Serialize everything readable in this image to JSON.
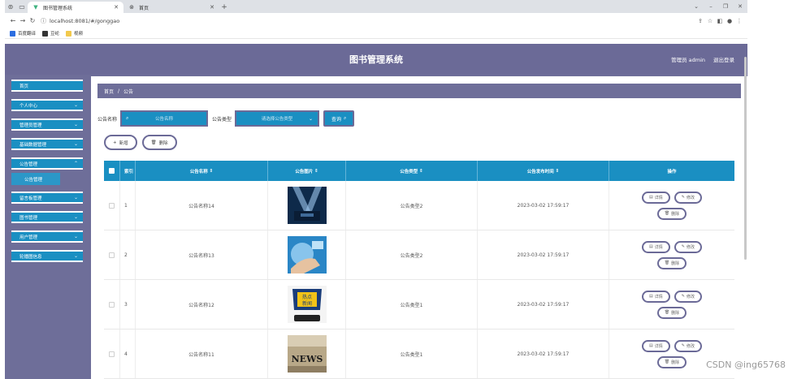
{
  "browser": {
    "tabs": [
      {
        "title": "图书管理系统",
        "active": true
      },
      {
        "title": "首页",
        "active": false
      }
    ],
    "new_tab": "+",
    "url": "localhost:8081/#/gonggao",
    "bookmarks": [
      "百度翻译",
      "豆纶",
      "视频"
    ]
  },
  "app": {
    "title": "图书管理系统",
    "user_label": "管理员 admin",
    "logout": "退出登录"
  },
  "sidebar": {
    "items": [
      {
        "label": "首页",
        "has_children": false
      },
      {
        "label": "个人中心",
        "has_children": true
      },
      {
        "label": "管理员管理",
        "has_children": true
      },
      {
        "label": "基础数据管理",
        "has_children": true
      },
      {
        "label": "公告管理",
        "has_children": true,
        "expanded": true
      },
      {
        "label": "留言板管理",
        "has_children": true
      },
      {
        "label": "图书管理",
        "has_children": true
      },
      {
        "label": "用户管理",
        "has_children": true
      },
      {
        "label": "轮播图信息",
        "has_children": true
      }
    ],
    "active_sub": "公告管理"
  },
  "breadcrumb": {
    "home": "首页",
    "sep": "/",
    "current": "公告"
  },
  "filters": {
    "name_label": "公告名称",
    "name_placeholder": "公告名称",
    "type_label": "公告类型",
    "type_placeholder": "请选择公告类型",
    "search_button": "查询"
  },
  "actions": {
    "add": "新增",
    "delete": "删除"
  },
  "table": {
    "headers": [
      "索引",
      "公告名称",
      "公告图片",
      "公告类型",
      "公告发布时间",
      "操作"
    ],
    "rows": [
      {
        "index": "1",
        "name": "公告名称14",
        "type": "公告类型2",
        "time": "2023-03-02 17:59:17"
      },
      {
        "index": "2",
        "name": "公告名称13",
        "type": "公告类型2",
        "time": "2023-03-02 17:59:17"
      },
      {
        "index": "3",
        "name": "公告名称12",
        "type": "公告类型1",
        "time": "2023-03-02 17:59:17"
      },
      {
        "index": "4",
        "name": "公告名称11",
        "type": "公告类型1",
        "time": "2023-03-02 17:59:17"
      }
    ],
    "row_buttons": {
      "detail": "详情",
      "edit": "修改",
      "delete": "删除"
    }
  },
  "watermark": "CSDN @ing65768",
  "colors": {
    "accent": "#1a8fc2",
    "theme": "#6b6a97"
  }
}
